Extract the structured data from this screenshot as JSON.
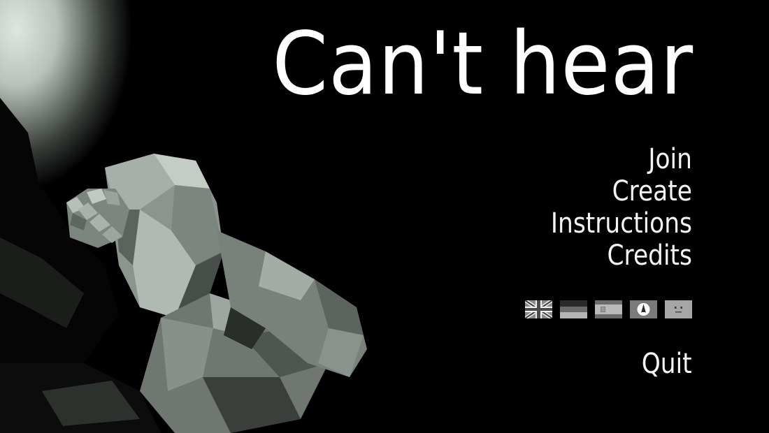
{
  "title": "Can't hear",
  "menu": {
    "items": [
      {
        "label": "Join"
      },
      {
        "label": "Create"
      },
      {
        "label": "Instructions"
      },
      {
        "label": "Credits"
      }
    ],
    "quit_label": "Quit"
  },
  "languages": [
    {
      "icon": "uk-flag-icon"
    },
    {
      "icon": "german-flag-icon"
    },
    {
      "icon": "spanish-flag-icon"
    },
    {
      "icon": "esperanto-flag-icon"
    },
    {
      "icon": "smiley-flag-icon"
    }
  ],
  "colors": {
    "background": "#000000",
    "text": "#f4f4f4",
    "spotlight": "#c9d2cb",
    "figure_shade": "#6f7770"
  }
}
